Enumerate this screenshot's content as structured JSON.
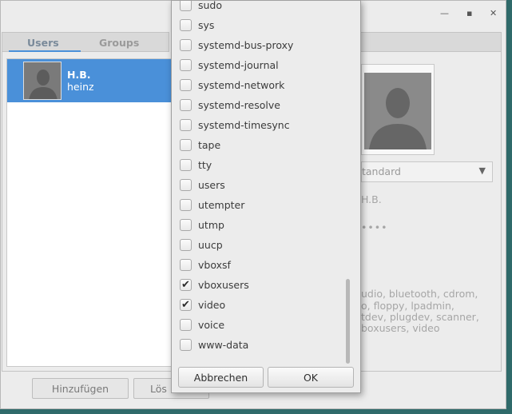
{
  "window": {
    "controls": [
      "—",
      "▪",
      "✕"
    ]
  },
  "tabs": [
    {
      "label": "Users"
    },
    {
      "label": "Groups"
    }
  ],
  "users": [
    {
      "name": "H.B.",
      "login": "heinz",
      "avatar_icon": "user-avatar-icon"
    }
  ],
  "details": {
    "account_type": "tandard",
    "full_name": "H.B.",
    "password_mask": "••••",
    "groups_lines": [
      "udio, bluetooth, cdrom,",
      "o, floppy, lpadmin,",
      "tdev, plugdev, scanner,",
      "boxusers, video"
    ]
  },
  "bottom_buttons": {
    "add": "Hinzufügen",
    "delete": "Lös"
  },
  "popup": {
    "items": [
      {
        "label": "sudo",
        "checked": false
      },
      {
        "label": "sys",
        "checked": false
      },
      {
        "label": "systemd-bus-proxy",
        "checked": false
      },
      {
        "label": "systemd-journal",
        "checked": false
      },
      {
        "label": "systemd-network",
        "checked": false
      },
      {
        "label": "systemd-resolve",
        "checked": false
      },
      {
        "label": "systemd-timesync",
        "checked": false
      },
      {
        "label": "tape",
        "checked": false
      },
      {
        "label": "tty",
        "checked": false
      },
      {
        "label": "users",
        "checked": false
      },
      {
        "label": "utempter",
        "checked": false
      },
      {
        "label": "utmp",
        "checked": false
      },
      {
        "label": "uucp",
        "checked": false
      },
      {
        "label": "vboxsf",
        "checked": false
      },
      {
        "label": "vboxusers",
        "checked": true
      },
      {
        "label": "video",
        "checked": true
      },
      {
        "label": "voice",
        "checked": false
      },
      {
        "label": "www-data",
        "checked": false
      }
    ],
    "cancel_label": "Abbrechen",
    "ok_label": "OK",
    "check_glyph": "✔"
  }
}
